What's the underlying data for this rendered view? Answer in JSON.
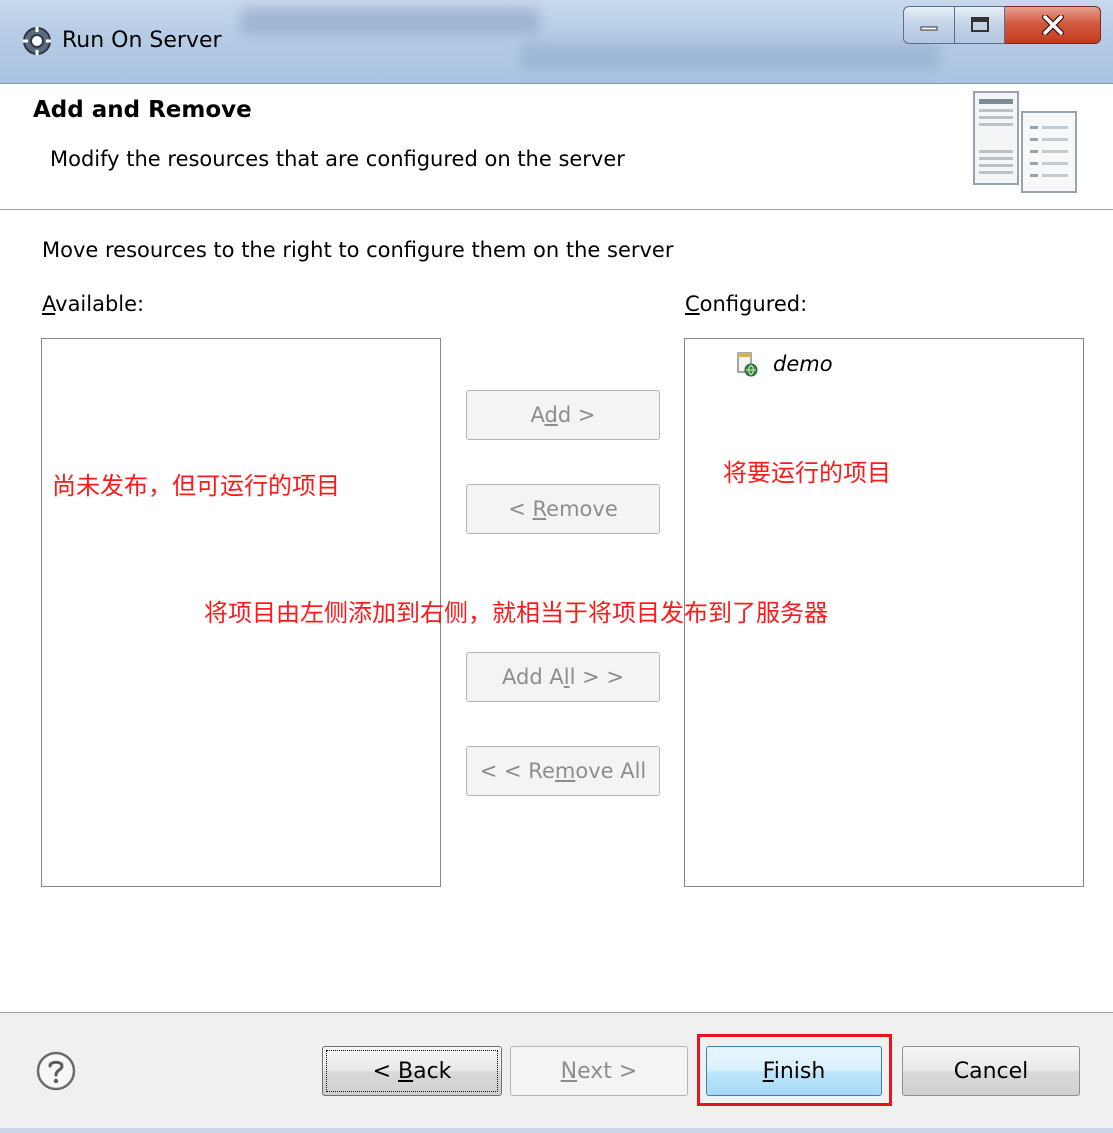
{
  "window": {
    "title": "Run On Server"
  },
  "header": {
    "title": "Add and Remove",
    "description": "Modify the resources that are configured on the server"
  },
  "main": {
    "instruction": "Move resources to the right to configure them on the server",
    "available_label_prefix": "A",
    "available_label_rest": "vailable:",
    "configured_label_prefix": "C",
    "configured_label_rest": "onfigured:",
    "available_items": [],
    "configured_items": [
      {
        "label": "demo",
        "icon": "web-project-icon"
      }
    ]
  },
  "buttons": {
    "add": {
      "pre": "A",
      "mnemonic": "d",
      "post": "d >"
    },
    "remove": {
      "pre": "< ",
      "mnemonic": "R",
      "post": "emove"
    },
    "add_all": {
      "pre": "Add A",
      "mnemonic": "l",
      "post": "l > >"
    },
    "remove_all": {
      "pre": "< < Re",
      "mnemonic": "m",
      "post": "ove All"
    }
  },
  "annotations": {
    "left": "尚未发布，但可运行的项目",
    "right": "将要运行的项目",
    "middle": "将项目由左侧添加到右侧，就相当于将项目发布到了服务器"
  },
  "footer": {
    "back": {
      "pre": "< ",
      "mnemonic": "B",
      "post": "ack"
    },
    "next": {
      "pre": "",
      "mnemonic": "N",
      "post": "ext >"
    },
    "finish": {
      "pre": "",
      "mnemonic": "F",
      "post": "inish"
    },
    "cancel": "Cancel"
  },
  "colors": {
    "annotation": "#ff1a1a",
    "highlight_box": "#e8141b",
    "disabled_text": "#8d8d8d"
  }
}
